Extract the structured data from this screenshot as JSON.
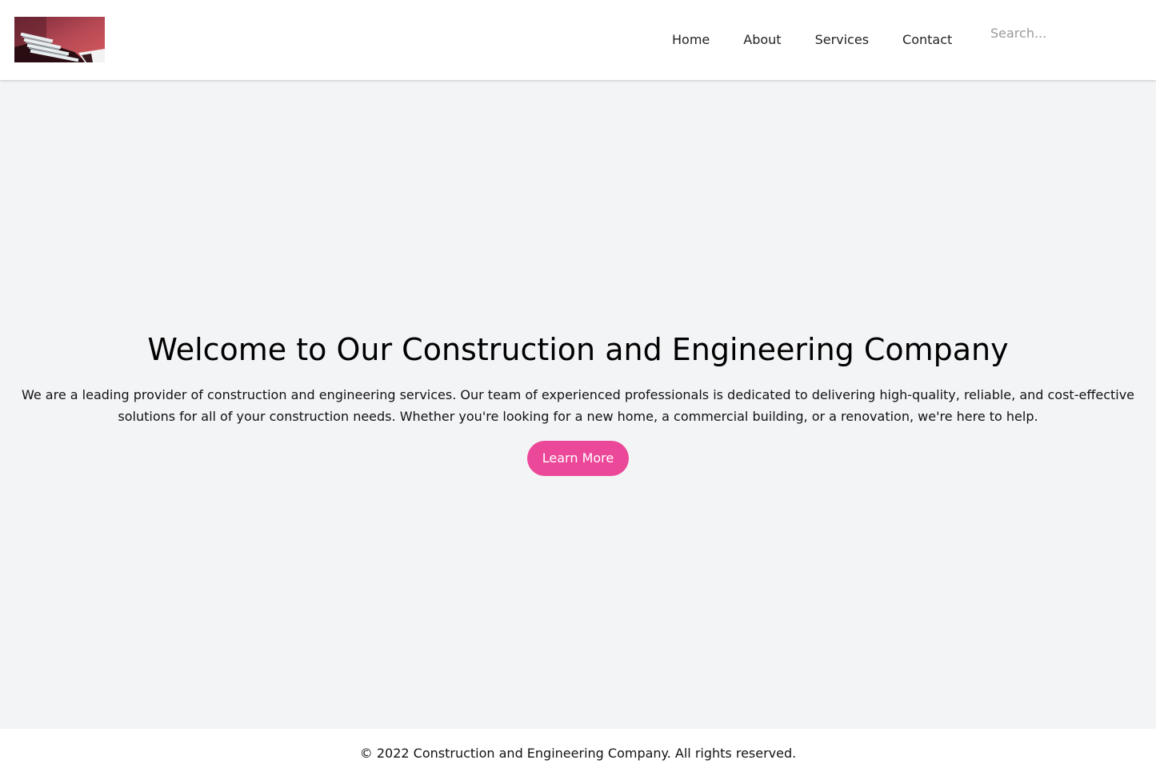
{
  "header": {
    "logo_alt": "",
    "nav": [
      {
        "label": "Home"
      },
      {
        "label": "About"
      },
      {
        "label": "Services"
      },
      {
        "label": "Contact"
      }
    ],
    "search": {
      "placeholder": "Search...",
      "value": ""
    }
  },
  "hero": {
    "title": "Welcome to Our Construction and Engineering Company",
    "text": "We are a leading provider of construction and engineering services. Our team of experienced professionals is dedicated to delivering high-quality, reliable, and cost-effective solutions for all of your construction needs. Whether you're looking for a new home, a commercial building, or a renovation, we're here to help.",
    "cta_label": "Learn More"
  },
  "footer": {
    "copyright": "© 2022 Construction and Engineering Company. All rights reserved."
  },
  "colors": {
    "accent": "#ec4899",
    "page_background": "#f3f4f6",
    "header_background": "#ffffff"
  }
}
